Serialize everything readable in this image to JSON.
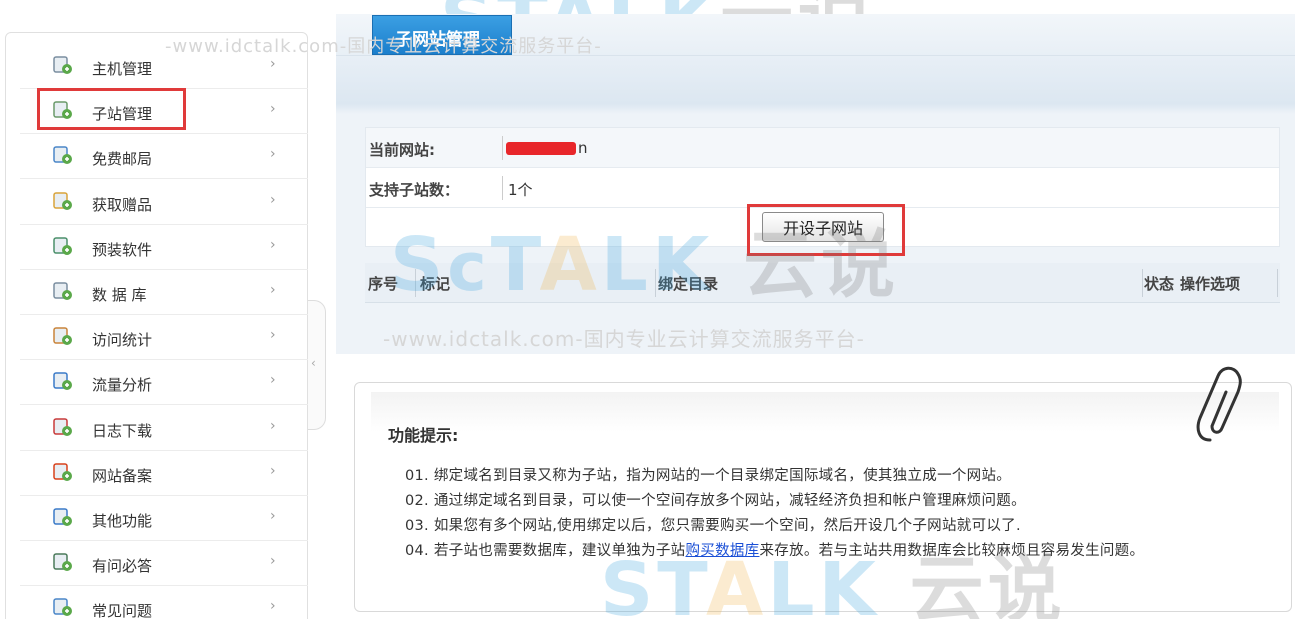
{
  "watermark": {
    "text": "-www.idctalk.com-国内专业云计算交流服务平台-",
    "logo": [
      "TALK",
      "云说"
    ]
  },
  "sidebar": {
    "items": [
      {
        "label": "主机管理",
        "icon": "server-icon"
      },
      {
        "label": "子站管理",
        "icon": "subsite-icon"
      },
      {
        "label": "免费邮局",
        "icon": "mail-icon"
      },
      {
        "label": "获取赠品",
        "icon": "gift-box-icon"
      },
      {
        "label": "预装软件",
        "icon": "software-icon"
      },
      {
        "label": "数 据 库",
        "icon": "database-icon"
      },
      {
        "label": "访问统计",
        "icon": "stats-icon"
      },
      {
        "label": "流量分析",
        "icon": "traffic-icon"
      },
      {
        "label": "日志下载",
        "icon": "calendar-icon"
      },
      {
        "label": "网站备案",
        "icon": "record-icon"
      },
      {
        "label": "其他功能",
        "icon": "wrench-icon"
      },
      {
        "label": "有问必答",
        "icon": "user-help-icon"
      },
      {
        "label": "常见问题",
        "icon": "faq-icon"
      }
    ],
    "arrow": "›",
    "collapse": "‹"
  },
  "tab": {
    "label": "子网站管理"
  },
  "info": {
    "current_site_label": "当前网站:",
    "current_site_value_suffix": "n",
    "subsite_count_label": "支持子站数：",
    "subsite_count_value": "1个",
    "create_button": "开设子网站"
  },
  "grid": {
    "columns": [
      "序号",
      "标记",
      "绑定目录",
      "状态",
      "操作选项"
    ]
  },
  "tips": {
    "title": "功能提示:",
    "lines": [
      {
        "text": "01. 绑定域名到目录又称为子站，指为网站的一个目录绑定国际域名，使其独立成一个网站。"
      },
      {
        "text": "02. 通过绑定域名到目录，可以使一个空间存放多个网站，减轻经济负担和帐户管理麻烦问题。"
      },
      {
        "text": "03. 如果您有多个网站,使用绑定以后，您只需要购买一个空间，然后开设几个子网站就可以了."
      },
      {
        "prefix": "04. 若子站也需要数据库，建议单独为子站",
        "link": "购买数据库",
        "suffix": "来存放。若与主站共用数据库会比较麻烦且容易发生问题。"
      }
    ]
  },
  "colors": {
    "highlight": "#e03a3a",
    "tab": "#2b8fd8",
    "link": "#1a4fd6"
  }
}
